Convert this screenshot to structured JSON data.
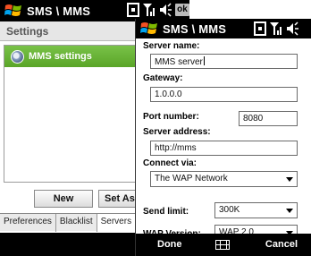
{
  "background_window": {
    "title": "SMS \\ MMS",
    "ok_label": "ok",
    "header": "Settings",
    "list": [
      {
        "label": "MMS settings",
        "selected": true
      }
    ],
    "buttons": {
      "new_label": "New",
      "set_default_label": "Set As D"
    },
    "tabs": [
      {
        "label": "Preferences",
        "active": false
      },
      {
        "label": "Blacklist",
        "active": false
      },
      {
        "label": "Servers",
        "active": true
      },
      {
        "label": "A",
        "active": false
      }
    ],
    "selection_color": "#5aa528"
  },
  "dialog": {
    "title": "SMS \\ MMS",
    "server_name": {
      "label": "Server name:",
      "value": "MMS server"
    },
    "gateway": {
      "label": "Gateway:",
      "value": "1.0.0.0"
    },
    "port": {
      "label": "Port number:",
      "value": "8080"
    },
    "server_address": {
      "label": "Server address:",
      "value": "http://mms"
    },
    "connect_via": {
      "label": "Connect via:",
      "value": "The WAP Network"
    },
    "send_limit": {
      "label": "Send limit:",
      "value": "300K"
    },
    "wap_version": {
      "label": "WAP Version:",
      "value": "WAP 2.0"
    },
    "softkeys": {
      "left": "Done",
      "right": "Cancel",
      "center_icon": "keyboard-icon"
    }
  },
  "status_icons": [
    "h-network-icon",
    "signal-icon",
    "speaker-icon"
  ]
}
